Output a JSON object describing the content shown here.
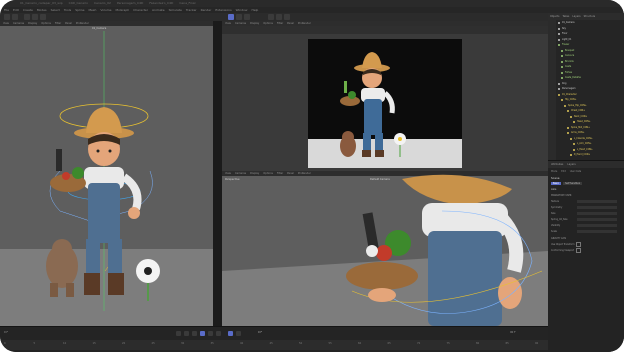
{
  "window": {
    "tabs": [
      "01_Cenario_cadepar_03_wip",
      "C4D_Cenario",
      "Cenario_02",
      "Personagem_C4D",
      "Fazendeiro_C4D",
      "Cena_Final"
    ]
  },
  "menu": [
    "File",
    "Edit",
    "Create",
    "Modes",
    "Select",
    "Tools",
    "Spline",
    "Mesh",
    "Volume",
    "MoGraph",
    "Character",
    "Animate",
    "Simulate",
    "Tracker",
    "Render",
    "Extensions",
    "Window",
    "Help"
  ],
  "viewport_menu": [
    "View",
    "Cameras",
    "Display",
    "Options",
    "Filter",
    "Panel",
    "ProRender"
  ],
  "viewports": {
    "left": {
      "label": "01_Camera"
    },
    "top_right": {
      "label": "Perspective"
    },
    "bottom_right": {
      "label": "Perspective",
      "sublabel": "Default Camera"
    }
  },
  "right_panel": {
    "tabs": [
      "Objects",
      "Takes",
      "Layers",
      "Structure"
    ],
    "objects": [
      {
        "name": "01_Camera",
        "depth": 0,
        "color": "#c9c9c9"
      },
      {
        "name": "Sky",
        "depth": 0,
        "color": "#c9c9c9"
      },
      {
        "name": "Floor",
        "depth": 0,
        "color": "#c9c9c9"
      },
      {
        "name": "Light_01",
        "depth": 0,
        "color": "#c9c9c9"
      },
      {
        "name": "Flower",
        "depth": 0,
        "color": "#9fd07a"
      },
      {
        "name": "Bouquet",
        "depth": 1,
        "color": "#9fd07a"
      },
      {
        "name": "Cenoura",
        "depth": 1,
        "color": "#9fd07a"
      },
      {
        "name": "Brocolis",
        "depth": 1,
        "color": "#9fd07a"
      },
      {
        "name": "Cesta",
        "depth": 1,
        "color": "#9fd07a"
      },
      {
        "name": "Folhas",
        "depth": 1,
        "color": "#9fd07a"
      },
      {
        "name": "Cesta_Detalhe",
        "depth": 1,
        "color": "#9fd07a"
      },
      {
        "name": "Dog",
        "depth": 0,
        "color": "#c9c9c9"
      },
      {
        "name": "Personagem",
        "depth": 0,
        "color": "#c9c9c9"
      },
      {
        "name": "01_Character",
        "depth": 0,
        "color": "#e0c85a"
      },
      {
        "name": "Hip_CON+",
        "depth": 1,
        "color": "#e0c85a"
      },
      {
        "name": "Spine_Hip_CON+",
        "depth": 2,
        "color": "#e0c85a"
      },
      {
        "name": "Chest_CON+",
        "depth": 3,
        "color": "#e0c85a"
      },
      {
        "name": "Neck_CON+",
        "depth": 4,
        "color": "#e0c85a"
      },
      {
        "name": "Head_CON+",
        "depth": 5,
        "color": "#e0c85a"
      },
      {
        "name": "Spine_Mid_CON+",
        "depth": 3,
        "color": "#e0c85a"
      },
      {
        "name": "Arms_CON+",
        "depth": 3,
        "color": "#e0c85a"
      },
      {
        "name": "L_Clavicle_CON+",
        "depth": 4,
        "color": "#e0c85a"
      },
      {
        "name": "L_Arm_CON+",
        "depth": 5,
        "color": "#e0c85a"
      },
      {
        "name": "L_Hand_CON+",
        "depth": 5,
        "color": "#e0c85a"
      },
      {
        "name": "R_Hand_CON+",
        "depth": 4,
        "color": "#e0c85a"
      }
    ],
    "attributes": {
      "tabs": [
        "Attributes",
        "Layers"
      ],
      "mode_items": [
        "Mode",
        "Edit",
        "User Data"
      ],
      "object_name": "Scene",
      "sub_tabs": [
        "Basic",
        "Self Sandbox"
      ],
      "section": "Axis",
      "group1": "MANDATORY USER",
      "rows": [
        "Texture",
        "Symmetry",
        "Size",
        "Spring_02_Size",
        "Visibility",
        "Scale"
      ],
      "group2": "GRAVITY AXIS",
      "checks": [
        "Use Object Transform",
        "Conforming Viewport"
      ]
    }
  },
  "timeline": {
    "frame_current": "0 F",
    "fps": "0 F",
    "end": "90 F",
    "ticks": [
      "0",
      "5",
      "10",
      "15",
      "20",
      "25",
      "30",
      "35",
      "40",
      "45",
      "50",
      "55",
      "60",
      "65",
      "70",
      "75",
      "80",
      "85",
      "90"
    ]
  },
  "colors": {
    "accent": "#5a6cc8",
    "viewport_bg": "#5e5e5e",
    "viewport_floor": "#7d7d7d",
    "ui_bg": "#242424"
  }
}
